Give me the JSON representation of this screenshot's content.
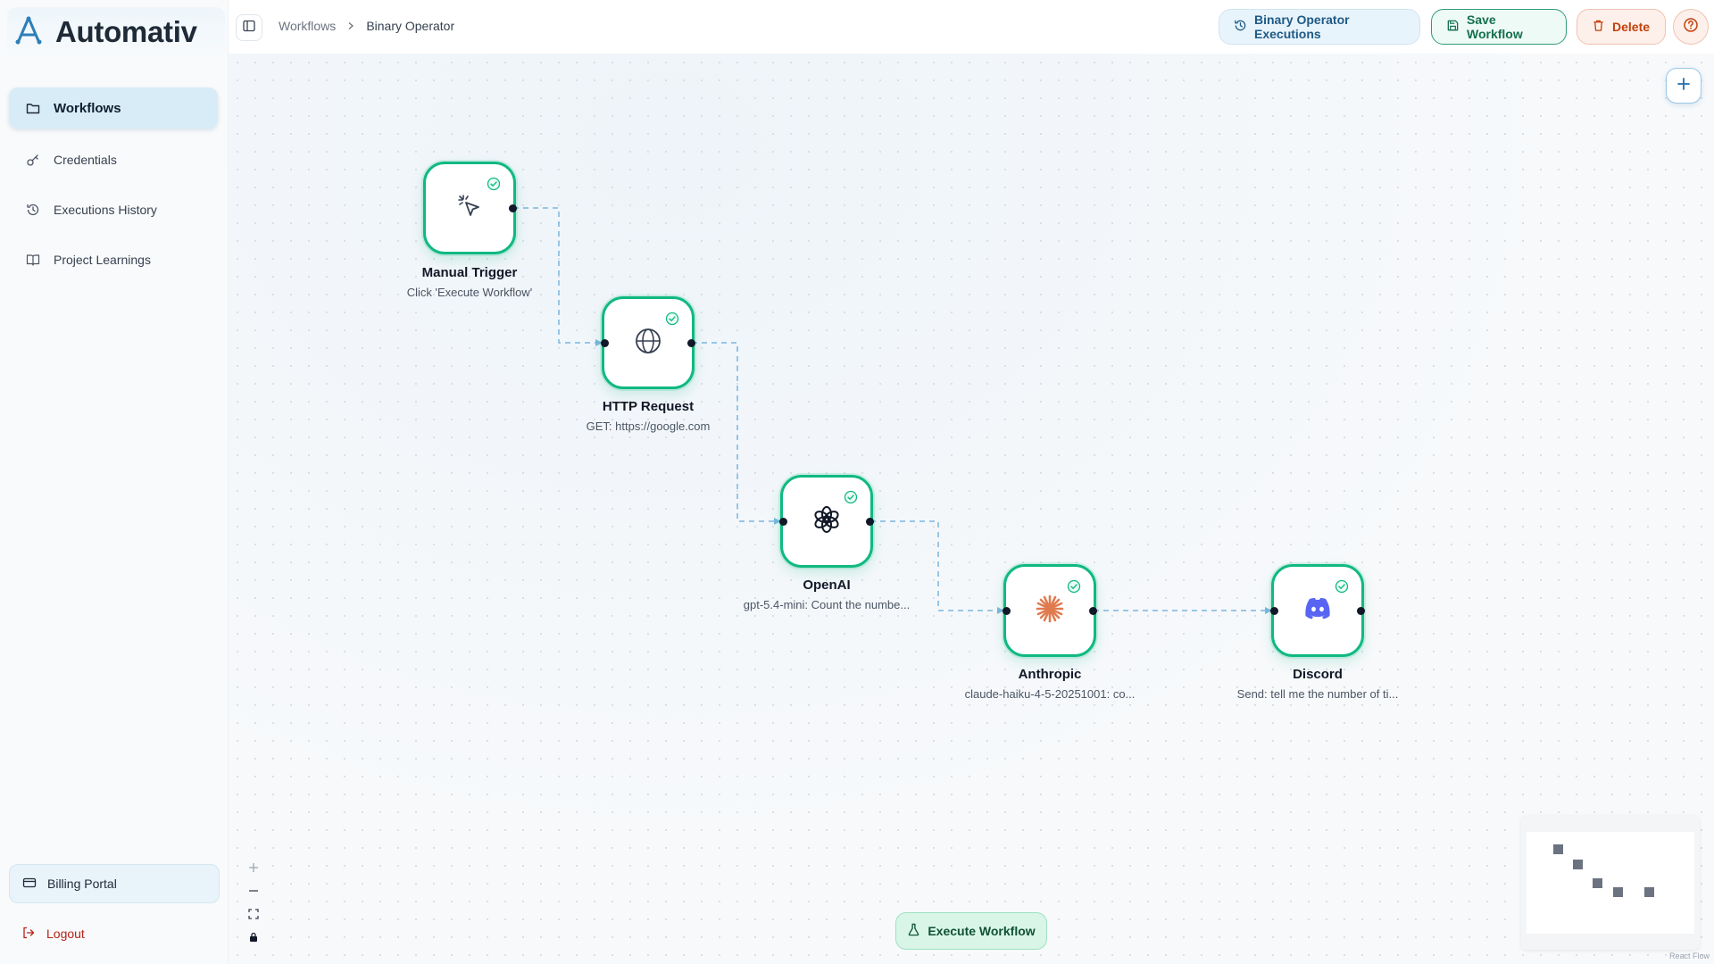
{
  "app": {
    "brand": "Automativ",
    "accent_color": "#10b981",
    "brand_color": "#2d7fb8"
  },
  "sidebar": {
    "items": [
      {
        "label": "Workflows",
        "icon": "folder-icon",
        "active": true
      },
      {
        "label": "Credentials",
        "icon": "key-icon",
        "active": false
      },
      {
        "label": "Executions History",
        "icon": "history-icon",
        "active": false
      },
      {
        "label": "Project Learnings",
        "icon": "book-icon",
        "active": false
      }
    ],
    "billing_label": "Billing Portal",
    "logout_label": "Logout"
  },
  "header": {
    "breadcrumb": [
      "Workflows",
      "Binary Operator"
    ],
    "executions_button": "Binary Operator Executions",
    "save_button": "Save Workflow",
    "delete_button": "Delete"
  },
  "workflow": {
    "nodes": [
      {
        "title": "Manual Trigger",
        "subtitle": "Click 'Execute Workflow'",
        "icon": "cursor-click-icon",
        "status": "success"
      },
      {
        "title": "HTTP Request",
        "subtitle": "GET: https://google.com",
        "icon": "globe-icon",
        "status": "success"
      },
      {
        "title": "OpenAI",
        "subtitle": "gpt-5.4-mini: Count the numbe...",
        "icon": "openai-icon",
        "status": "success"
      },
      {
        "title": "Anthropic",
        "subtitle": "claude-haiku-4-5-20251001: co...",
        "icon": "anthropic-icon",
        "status": "success"
      },
      {
        "title": "Discord",
        "subtitle": "Send: tell me the number of ti...",
        "icon": "discord-icon",
        "status": "success"
      }
    ],
    "execute_button": "Execute Workflow"
  },
  "footer": {
    "attribution": "React Flow"
  }
}
